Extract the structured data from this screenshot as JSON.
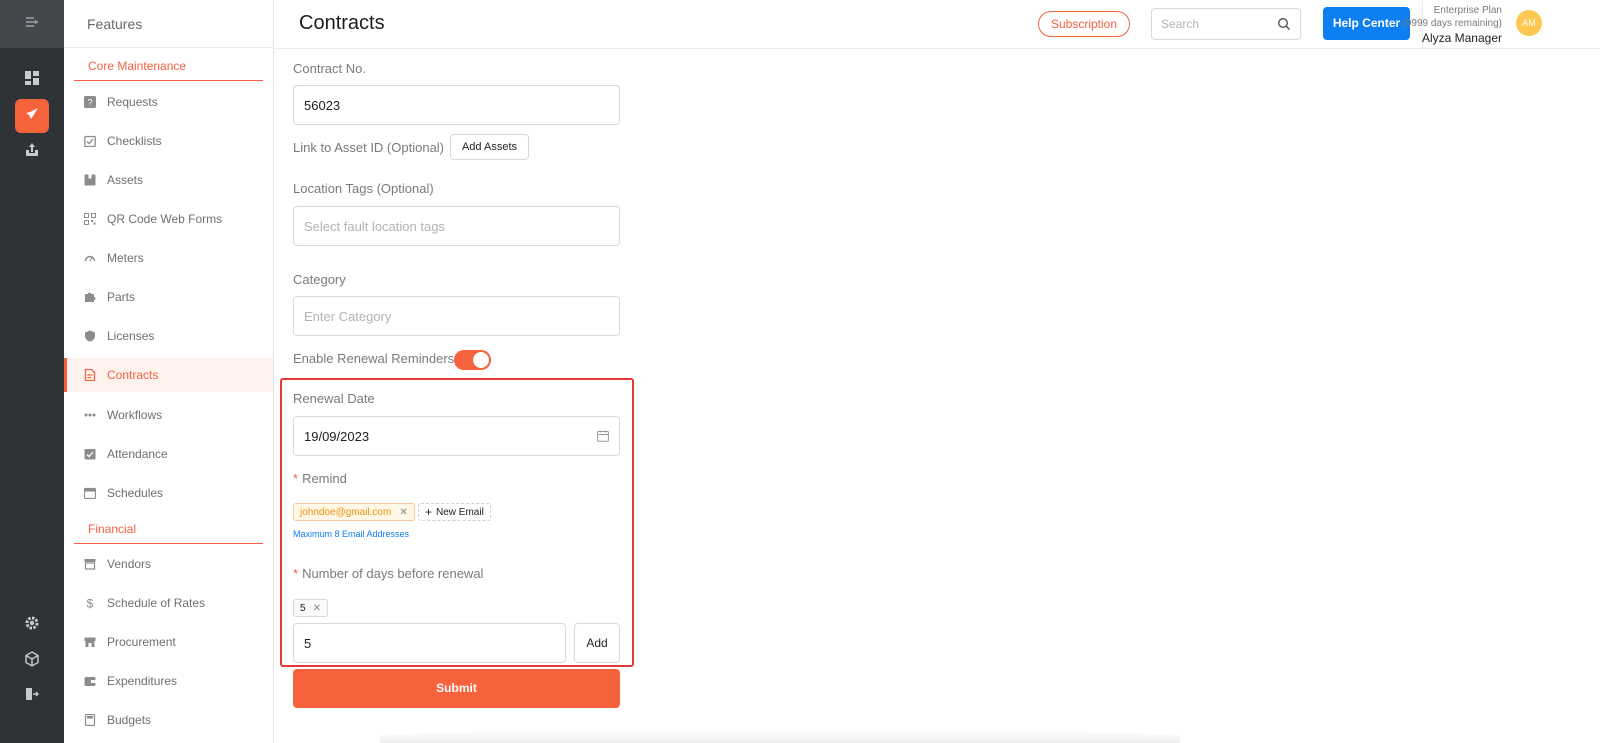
{
  "features_title": "Features",
  "page_title": "Contracts",
  "topbar": {
    "subscription_label": "Subscription",
    "search_placeholder": "Search",
    "help_label": "Help Center",
    "plan_line1": "Enterprise Plan",
    "plan_line2": "(9999 days remaining)",
    "user_name": "Alyza Manager",
    "avatar_initials": "AM"
  },
  "rail": {
    "icons": [
      "menu-collapse-icon",
      "dashboard-icon",
      "rocket-icon",
      "chart-icon",
      "settings-icon",
      "cube-icon",
      "logout-icon"
    ],
    "accent": "#f5623c"
  },
  "sidebar": {
    "sections": [
      {
        "title": "Core Maintenance",
        "items": [
          {
            "label": "Requests",
            "icon": "question-icon"
          },
          {
            "label": "Checklists",
            "icon": "checklist-icon"
          },
          {
            "label": "Assets",
            "icon": "box-icon"
          },
          {
            "label": "QR Code Web Forms",
            "icon": "qr-icon"
          },
          {
            "label": "Meters",
            "icon": "gauge-icon"
          },
          {
            "label": "Parts",
            "icon": "puzzle-icon"
          },
          {
            "label": "Licenses",
            "icon": "shield-icon"
          },
          {
            "label": "Contracts",
            "icon": "document-icon",
            "active": true
          },
          {
            "label": "Workflows",
            "icon": "workflow-icon"
          },
          {
            "label": "Attendance",
            "icon": "attendance-icon"
          },
          {
            "label": "Schedules",
            "icon": "calendar-icon"
          }
        ]
      },
      {
        "title": "Financial",
        "items": [
          {
            "label": "Vendors",
            "icon": "store-icon"
          },
          {
            "label": "Schedule of Rates",
            "icon": "dollar-icon"
          },
          {
            "label": "Procurement",
            "icon": "shop-icon"
          },
          {
            "label": "Expenditures",
            "icon": "wallet-icon"
          },
          {
            "label": "Budgets",
            "icon": "calculator-icon"
          }
        ]
      }
    ]
  },
  "form": {
    "contract_no_label": "Contract No.",
    "contract_no_value": "56023",
    "link_asset_label": "Link to Asset ID (Optional)",
    "add_assets_label": "Add Assets",
    "location_tags_label": "Location Tags (Optional)",
    "location_tags_placeholder": "Select fault location tags",
    "category_label": "Category",
    "category_placeholder": "Enter Category",
    "renewal_toggle_label": "Enable Renewal Reminders",
    "renewal_toggle_on": true,
    "renewal_date_label": "Renewal Date",
    "renewal_date_value": "19/09/2023",
    "remind_label": "Remind",
    "remind_required_mark": "*",
    "email_tag": "johndoe@gmail.com",
    "new_email_label": "New Email",
    "email_hint": "Maximum 8 Email Addresses",
    "days_label": "Number of days before renewal",
    "days_tag": "5",
    "days_input_value": "5",
    "add_label": "Add",
    "submit_label": "Submit"
  }
}
